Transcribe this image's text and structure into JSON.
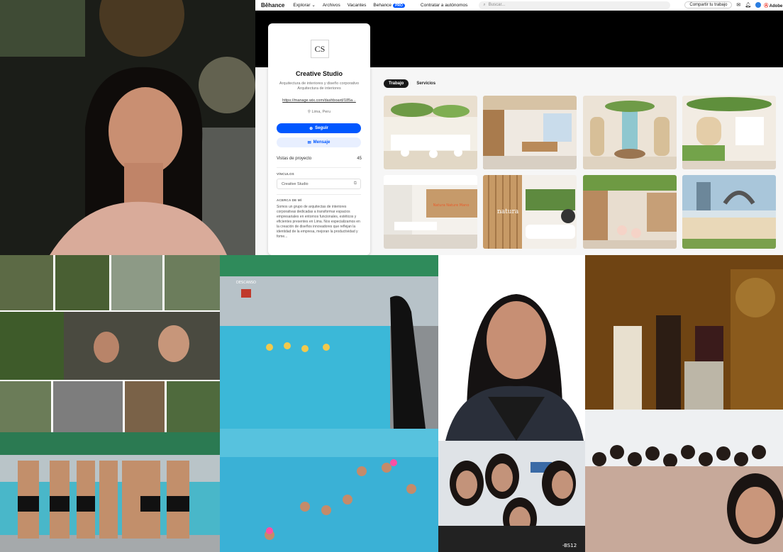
{
  "behance": {
    "topbar": {
      "logo": "Bēhance",
      "nav": [
        "Explorar ⌄",
        "Archivos",
        "Vacantes"
      ],
      "behance_pro_label": "Behance",
      "pro_badge": "PRO",
      "hire": "Contratar a autónomos",
      "search_placeholder": "Buscar...",
      "share_button": "Compartir tu trabajo",
      "adobe": "Adobe"
    },
    "profile": {
      "logo_text": "CS",
      "name": "Creative Studio",
      "description": "Arquitectura de interiores y diseño corporativo Arquitectura de interiores",
      "url": "https://manage.wix.com/dashboard/185a...",
      "location": "Lima, Peru",
      "follow_button": "Seguir",
      "message_button": "Mensaje",
      "project_views_label": "Vistas de proyecto",
      "project_views_value": "45",
      "links_title": "VÍNCULOS",
      "link_label": "Creative Studio",
      "about_title": "ACERCA DE MÍ",
      "about_text": "Somos un grupo de arquitectas de interiores corporativas dedicadas a transformar espacios empresariales en entornos funcionales, estéticos y eficientes presentes en Lima. Nos especializamos en la creación de diseños innovadores que reflejan la identidad de la empresa, mejoran la productividad y fome..."
    },
    "tabs": [
      "Trabajo",
      "Servicios"
    ],
    "thumb_logo_text": "natura",
    "thumb_sign_text": "Natura Nature Mano"
  },
  "photos": {
    "pool_sign": "DESCANSO",
    "shirt_text": "-BS12"
  },
  "colors": {
    "accent": "#0057ff",
    "pool_water": "#3bb8d8",
    "banner": "#000000"
  }
}
